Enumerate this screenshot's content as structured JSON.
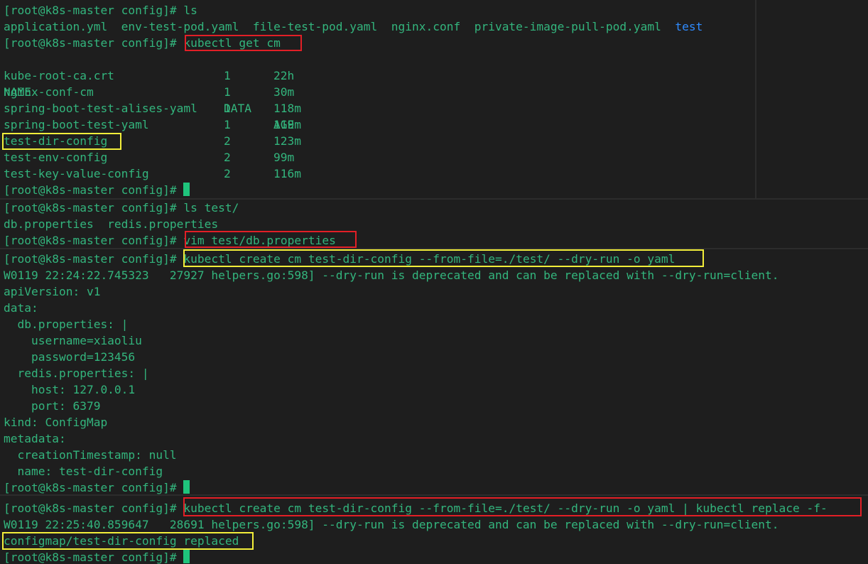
{
  "prompt": "[root@k8s-master config]#",
  "pane1": {
    "cmd_ls": "ls",
    "ls_files": "application.yml  env-test-pod.yaml  file-test-pod.yaml  nginx.conf  private-image-pull-pod.yaml",
    "ls_dir": "test",
    "cmd_get": "kubectl get cm",
    "header": {
      "name": "NAME",
      "data": "DATA",
      "age": "AGE"
    },
    "rows": [
      {
        "name": "kube-root-ca.crt",
        "data": "1",
        "age": "22h"
      },
      {
        "name": "nginx-conf-cm",
        "data": "1",
        "age": "30m"
      },
      {
        "name": "spring-boot-test-alises-yaml",
        "data": "1",
        "age": "118m"
      },
      {
        "name": "spring-boot-test-yaml",
        "data": "1",
        "age": "119m"
      },
      {
        "name": "test-dir-config",
        "data": "2",
        "age": "123m"
      },
      {
        "name": "test-env-config",
        "data": "2",
        "age": "99m"
      },
      {
        "name": "test-key-value-config",
        "data": "2",
        "age": "116m"
      }
    ]
  },
  "pane2": {
    "cmd_ls": "ls test/",
    "ls_output": "db.properties  redis.properties",
    "cmd_vim": "vim test/db.properties"
  },
  "pane3": {
    "cmd_create": "kubectl create cm test-dir-config --from-file=./test/ --dry-run -o yaml",
    "warning": "W0119 22:24:22.745323   27927 helpers.go:598] --dry-run is deprecated and can be replaced with --dry-run=client.",
    "yaml_lines": [
      "apiVersion: v1",
      "data:",
      "  db.properties: |",
      "    username=xiaoliu",
      "    password=123456",
      "  redis.properties: |",
      "    host: 127.0.0.1",
      "    port: 6379",
      "kind: ConfigMap",
      "metadata:",
      "  creationTimestamp: null",
      "  name: test-dir-config"
    ]
  },
  "pane4": {
    "cmd_replace": "kubectl create cm test-dir-config --from-file=./test/ --dry-run -o yaml | kubectl replace -f-",
    "warning": "W0119 22:25:40.859647   28691 helpers.go:598] --dry-run is deprecated and can be replaced with --dry-run=client.",
    "result": "configmap/test-dir-config replaced"
  },
  "colors": {
    "background": "#1e1e1e",
    "text": "#33b57d",
    "directory": "#2f8bff",
    "cursor": "#1fc47c",
    "highlight_red": "#e21f26",
    "highlight_yellow": "#f3ee3a"
  }
}
